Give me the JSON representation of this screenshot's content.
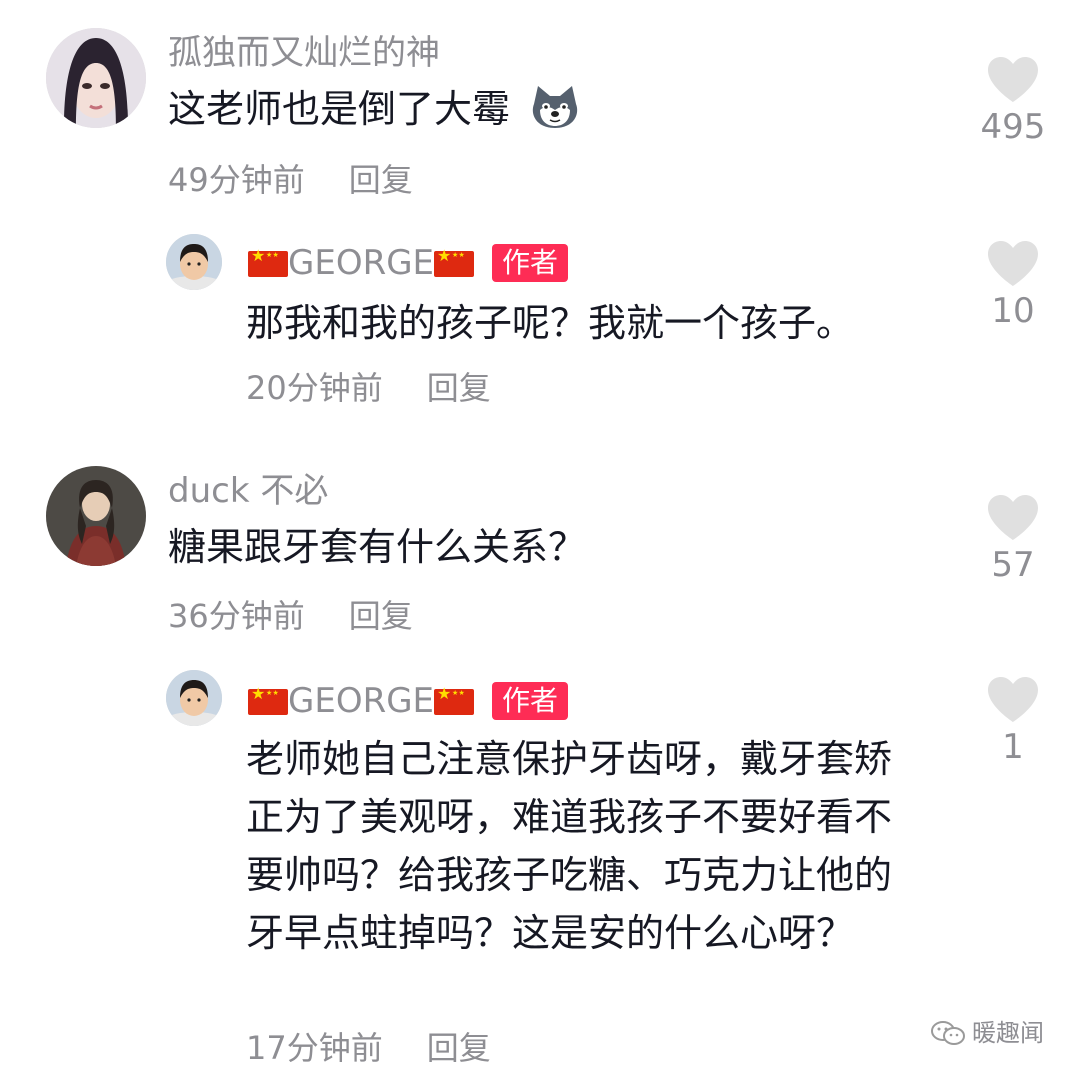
{
  "comments": [
    {
      "username": "孤独而又灿烂的神",
      "text": "这老师也是倒了大霉",
      "emoji": "husky-emoji",
      "time": "49分钟前",
      "reply": "回复",
      "likes": "495",
      "replies": [
        {
          "username": "GEORGE",
          "badge": "作者",
          "text": "那我和我的孩子呢？我就一个孩子。",
          "time": "20分钟前",
          "reply": "回复",
          "likes": "10"
        }
      ]
    },
    {
      "username": "duck 不必",
      "text": "糖果跟牙套有什么关系？",
      "time": "36分钟前",
      "reply": "回复",
      "likes": "57",
      "replies": [
        {
          "username": "GEORGE",
          "badge": "作者",
          "text": "老师她自己注意保护牙齿呀，戴牙套矫正为了美观呀，难道我孩子不要好看不要帅吗？给我孩子吃糖、巧克力让他的牙早点蛀掉吗？这是安的什么心呀？",
          "time": "17分钟前",
          "reply": "回复",
          "likes": "1"
        }
      ]
    }
  ],
  "watermark": "暖趣闻",
  "colors": {
    "badge": "#fe2c55",
    "secondary_text": "#8e8e93",
    "primary_text": "#161823",
    "heart": "#e0e0e0"
  }
}
